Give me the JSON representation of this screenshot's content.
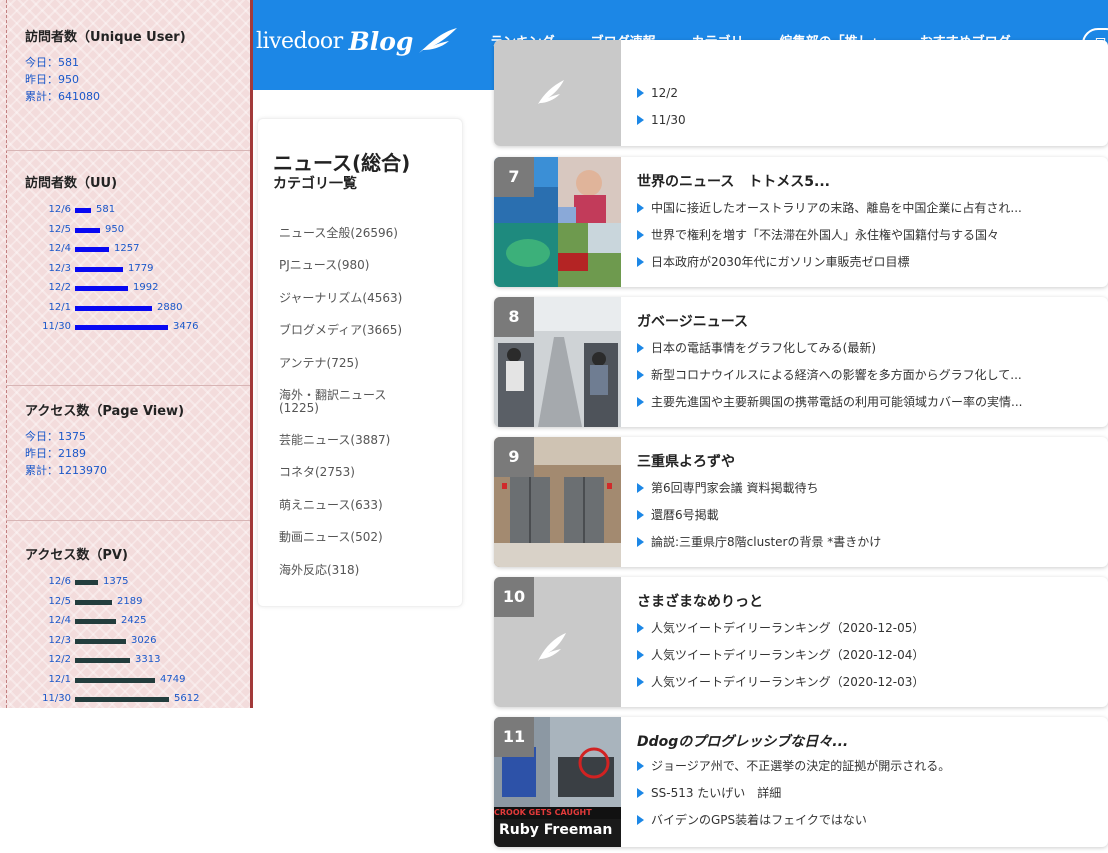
{
  "header": {
    "logo_text": "livedoor",
    "logo_blog": "Blog",
    "nav": [
      "ランキング",
      "ブログ速報",
      "カテゴリ",
      "編集部の「推し」",
      "おすすめブログ"
    ],
    "nav_pill": "ロ"
  },
  "stats": {
    "uu_title": "訪問者数（Unique User)",
    "uu_today": "今日：581",
    "uu_yesterday": "昨日：950",
    "uu_total": "累計：641080",
    "uu_chart_title": "訪問者数（UU)",
    "uu_chart": [
      {
        "date": "12/6",
        "value": 581
      },
      {
        "date": "12/5",
        "value": 950
      },
      {
        "date": "12/4",
        "value": 1257
      },
      {
        "date": "12/3",
        "value": 1779
      },
      {
        "date": "12/2",
        "value": 1992
      },
      {
        "date": "12/1",
        "value": 2880
      },
      {
        "date": "11/30",
        "value": 3476
      }
    ],
    "pv_title": "アクセス数（Page View)",
    "pv_today": "今日：1375",
    "pv_yesterday": "昨日：2189",
    "pv_total": "累計：1213970",
    "pv_chart_title": "アクセス数（PV)",
    "pv_chart": [
      {
        "date": "12/6",
        "value": 1375
      },
      {
        "date": "12/5",
        "value": 2189
      },
      {
        "date": "12/4",
        "value": 2425
      },
      {
        "date": "12/3",
        "value": 3026
      },
      {
        "date": "12/2",
        "value": 3313
      },
      {
        "date": "12/1",
        "value": 4749
      },
      {
        "date": "11/30",
        "value": 5612
      }
    ]
  },
  "category": {
    "title": "ニュース(総合)",
    "subtitle": "カテゴリ一覧",
    "items": [
      "ニュース全般(26596)",
      "PJニュース(980)",
      "ジャーナリズム(4563)",
      "ブログメディア(3665)",
      "アンテナ(725)",
      "海外・翻訳ニュース(1225)",
      "芸能ニュース(3887)",
      "コネタ(2753)",
      "萌えニュース(633)",
      "動画ニュース(502)",
      "海外反応(318)"
    ]
  },
  "ranking": {
    "partial": {
      "links": [
        "12/2",
        "11/30"
      ]
    },
    "entries": [
      {
        "num": "7",
        "title": "世界のニュース　トトメス5...",
        "links": [
          "中国に接近したオーストラリアの末路、離島を中国企業に占有され...",
          "世界で権利を増す「不法滞在外国人」永住権や国籍付与する国々",
          "日本政府が2030年代にガソリン車販売ゼロ目標"
        ]
      },
      {
        "num": "8",
        "title": "ガベージニュース",
        "links": [
          "日本の電話事情をグラフ化してみる(最新)",
          "新型コロナウイルスによる経済への影響を多方面からグラフ化して...",
          "主要先進国や主要新興国の携帯電話の利用可能領域カバー率の実情..."
        ]
      },
      {
        "num": "9",
        "title": "三重県よろずや",
        "links": [
          "第6回専門家会議 資料掲載待ち",
          "還暦6号掲載",
          "論説:三重県庁8階clusterの背景 *書きかけ"
        ]
      },
      {
        "num": "10",
        "title": "さまざまなめりっと",
        "links": [
          "人気ツイートデイリーランキング（2020-12-05）",
          "人気ツイートデイリーランキング（2020-12-04）",
          "人気ツイートデイリーランキング（2020-12-03）"
        ]
      },
      {
        "num": "11",
        "title": "Ddogのプログレッシブな日々...",
        "links": [
          "ジョージア州で、不正選挙の決定的証拠が開示される。",
          "SS-513 たいげい　詳細",
          "バイデンのGPS装着はフェイクではない"
        ]
      }
    ],
    "thumb11_caption1": "CROOK GETS CAUGHT",
    "thumb11_caption2": "Ruby Freeman"
  }
}
